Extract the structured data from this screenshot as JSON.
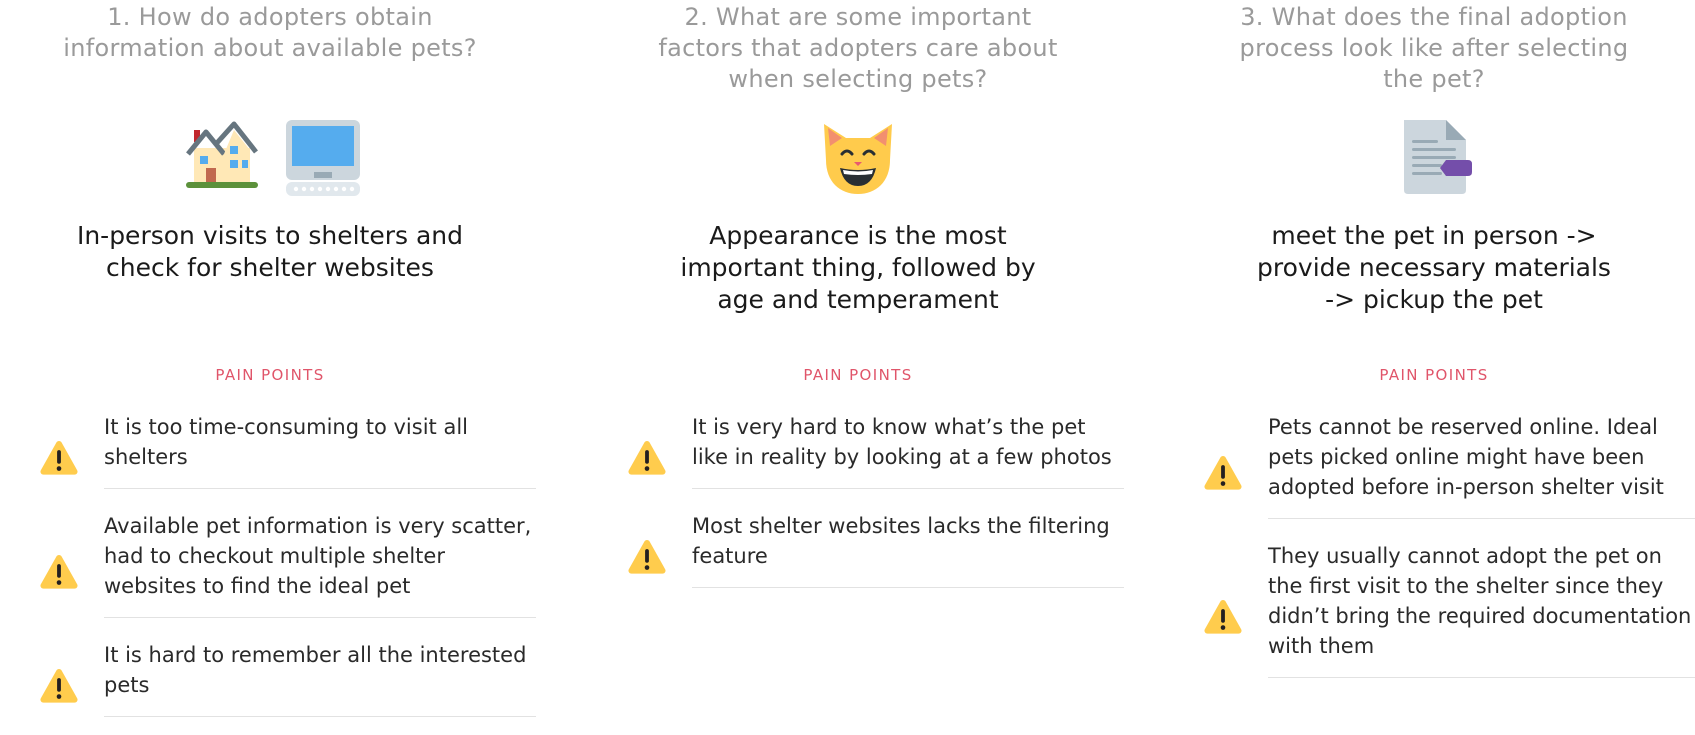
{
  "columns": [
    {
      "question": "1. How do adopters obtain\ninformation about available pets?",
      "icons": [
        "house-icon",
        "desktop-computer-icon"
      ],
      "answer": "In-person visits to shelters and\ncheck for shelter websites",
      "pain_header": "PAIN POINTS",
      "pain_points": [
        "It is too time-consuming to visit all shelters",
        "Available pet information is very scatter, had to checkout multiple shelter websites to find the ideal pet",
        "It is hard to remember all the interested pets"
      ]
    },
    {
      "question": "2. What are some important\nfactors that adopters care about\nwhen selecting pets?",
      "icons": [
        "grinning-cat-icon"
      ],
      "answer": "Appearance is the most\nimportant thing, followed by\nage and temperament",
      "pain_header": "PAIN POINTS",
      "pain_points": [
        "It is very hard to know what’s the pet like in reality by looking at a few photos",
        "Most shelter websites lacks the filtering feature"
      ]
    },
    {
      "question": "3. What does the final adoption\nprocess look like after selecting\nthe pet?",
      "icons": [
        "document-with-tag-icon"
      ],
      "answer": "meet the pet in person ->\nprovide necessary materials\n-> pickup the pet",
      "pain_header": "PAIN POINTS",
      "pain_points": [
        "Pets cannot be reserved online. Ideal pets picked online might have been adopted before in-person shelter visit",
        "They usually cannot adopt the pet on the first visit to the shelter since they didn’t bring the required documentation with them"
      ]
    }
  ],
  "colors": {
    "question_text": "#9a9a9a",
    "answer_text": "#1a1a1a",
    "pain_header": "#e0556a",
    "warning_yellow": "#ffcc4d",
    "divider": "#e2e2e2"
  }
}
